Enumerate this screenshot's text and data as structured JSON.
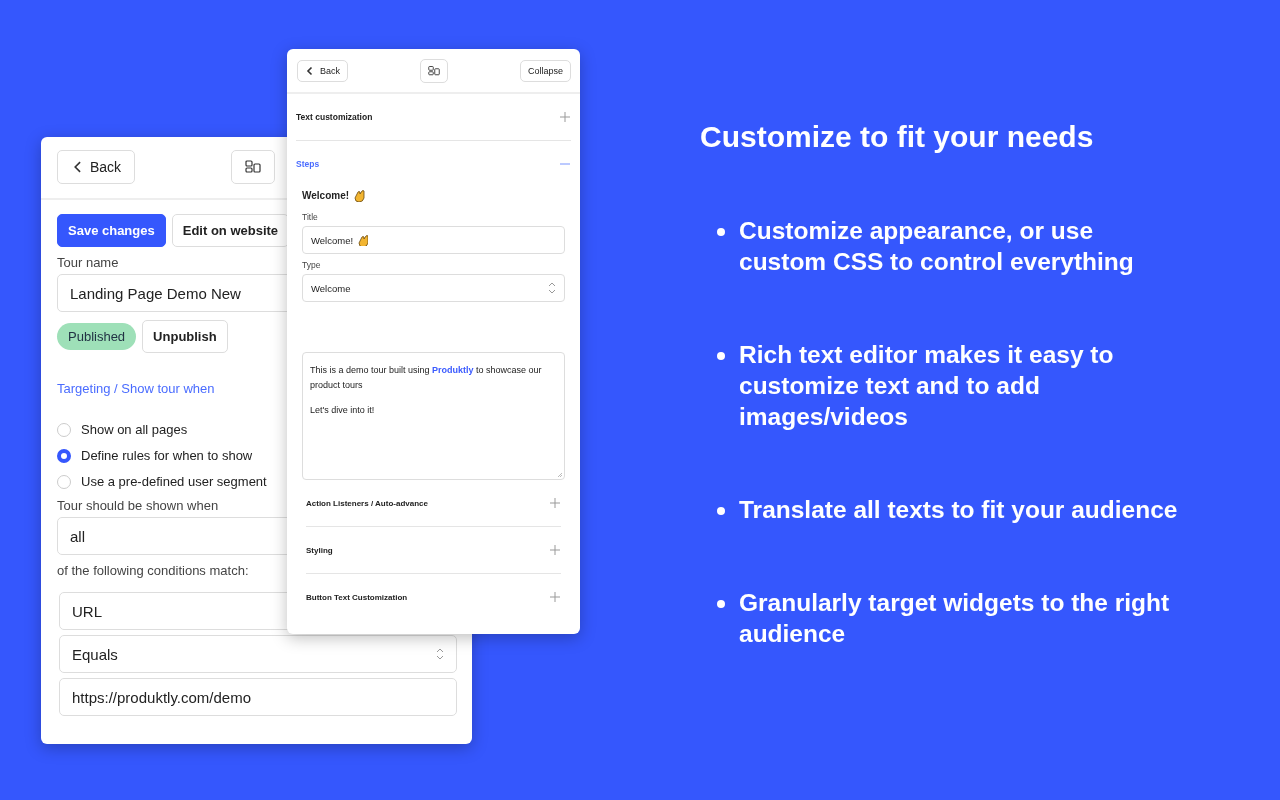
{
  "back_panel": {
    "header": {
      "back_button": "Back"
    },
    "actions": [
      {
        "label": "Save changes",
        "primary": true
      },
      {
        "label": "Edit on website",
        "primary": false
      }
    ],
    "tour_name": {
      "label": "Tour name",
      "value": "Landing Page Demo New"
    },
    "status": {
      "badge": "Published",
      "button": "Unpublish"
    },
    "targeting_link": "Targeting / Show tour when",
    "options": [
      {
        "label": "Show on all pages",
        "selected": false
      },
      {
        "label": "Define rules for when to show",
        "selected": true
      },
      {
        "label": "Use a pre-defined user segment",
        "selected": false
      }
    ],
    "shown_when": {
      "label": "Tour should be shown when",
      "value": "all"
    },
    "conditions_label": "of the following conditions match:",
    "condition_fields": [
      {
        "kind": "select",
        "value": "URL"
      },
      {
        "kind": "select",
        "value": "Equals"
      },
      {
        "kind": "input",
        "value": "https://produktly.com/demo"
      }
    ]
  },
  "front_panel": {
    "header": {
      "back_button": "Back",
      "collapse_button": "Collapse"
    },
    "sections": [
      {
        "title": "Text customization",
        "expanded": false
      },
      {
        "title": "Steps",
        "expanded": true
      }
    ],
    "step": {
      "heading": "Welcome!",
      "title_label": "Title",
      "title_value": "Welcome!",
      "type_label": "Type",
      "type_value": "Welcome",
      "body": [
        "This is a demo tour built using **Produktly** to showcase our product tours",
        "Let's dive into it!"
      ]
    },
    "subsections": [
      {
        "title": "Action Listeners / Auto-advance",
        "expanded": false
      },
      {
        "title": "Styling",
        "expanded": false
      },
      {
        "title": "Button Text Customization",
        "expanded": false
      }
    ]
  },
  "headline": "Customize to fit your needs",
  "bullets": [
    "Customize appearance, or use custom CSS to control everything",
    "Rich text editor makes it easy to customize text and to add images/videos",
    "Translate all texts to fit your audience",
    "Granularly target widgets to the right audience"
  ]
}
